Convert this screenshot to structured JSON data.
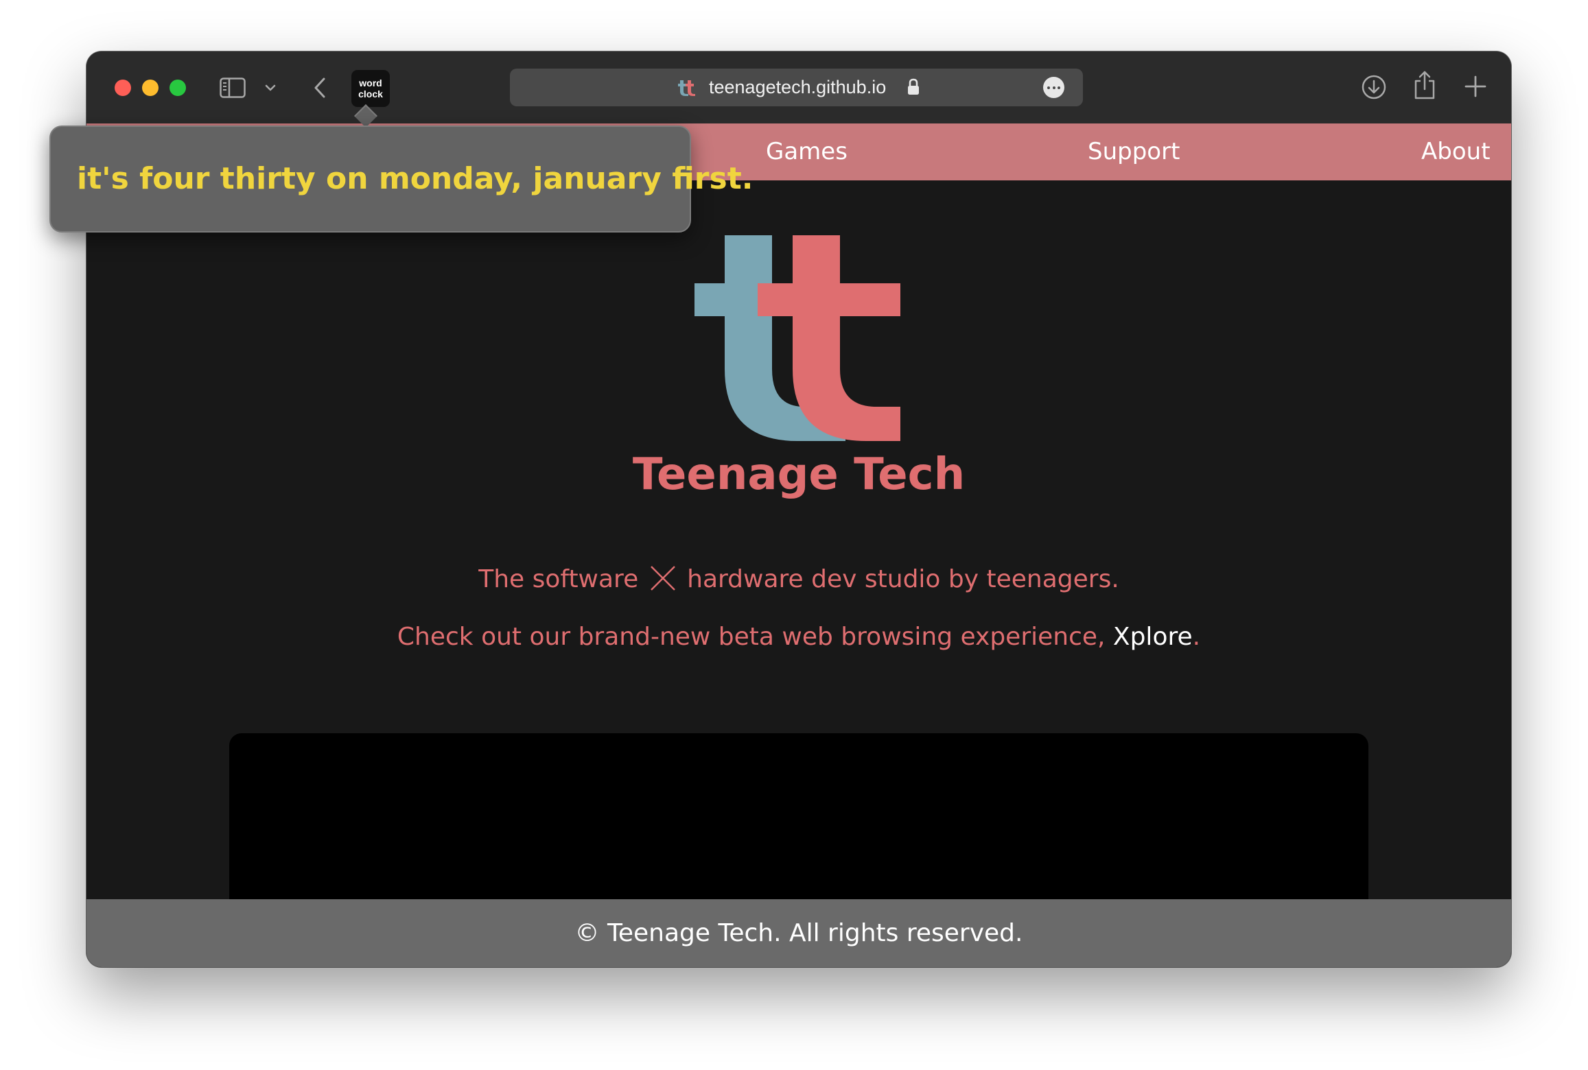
{
  "browser": {
    "url": "teenagetech.github.io",
    "extension": {
      "line1": "word",
      "line2": "clock"
    },
    "icons": {
      "sidebar": "sidebar-icon",
      "sidebar_menu": "chevron-down-icon",
      "back": "chevron-left-icon",
      "secure": "lock-icon",
      "page_menu": "more-icon",
      "downloads": "download-icon",
      "share": "share-icon",
      "new_tab": "plus-icon"
    }
  },
  "tooltip": {
    "text": "it's four thirty on monday, january first."
  },
  "nav": {
    "items": [
      {
        "label": "Games"
      },
      {
        "label": "Support"
      },
      {
        "label": "About"
      }
    ]
  },
  "hero": {
    "title": "Teenage Tech",
    "tagline_part1": "The software",
    "tagline_part2": "hardware dev studio by teenagers.",
    "promo_text": "Check out our brand-new beta web browsing experience, ",
    "promo_link": "Xplore",
    "promo_end": "."
  },
  "footer": {
    "text": "© Teenage Tech. All rights reserved."
  },
  "colors": {
    "brand_red": "#df6e70",
    "brand_blue": "#7aa6b4",
    "nav_background": "#c8797c",
    "page_background": "#181818",
    "tooltip_text": "#f0d53e"
  }
}
